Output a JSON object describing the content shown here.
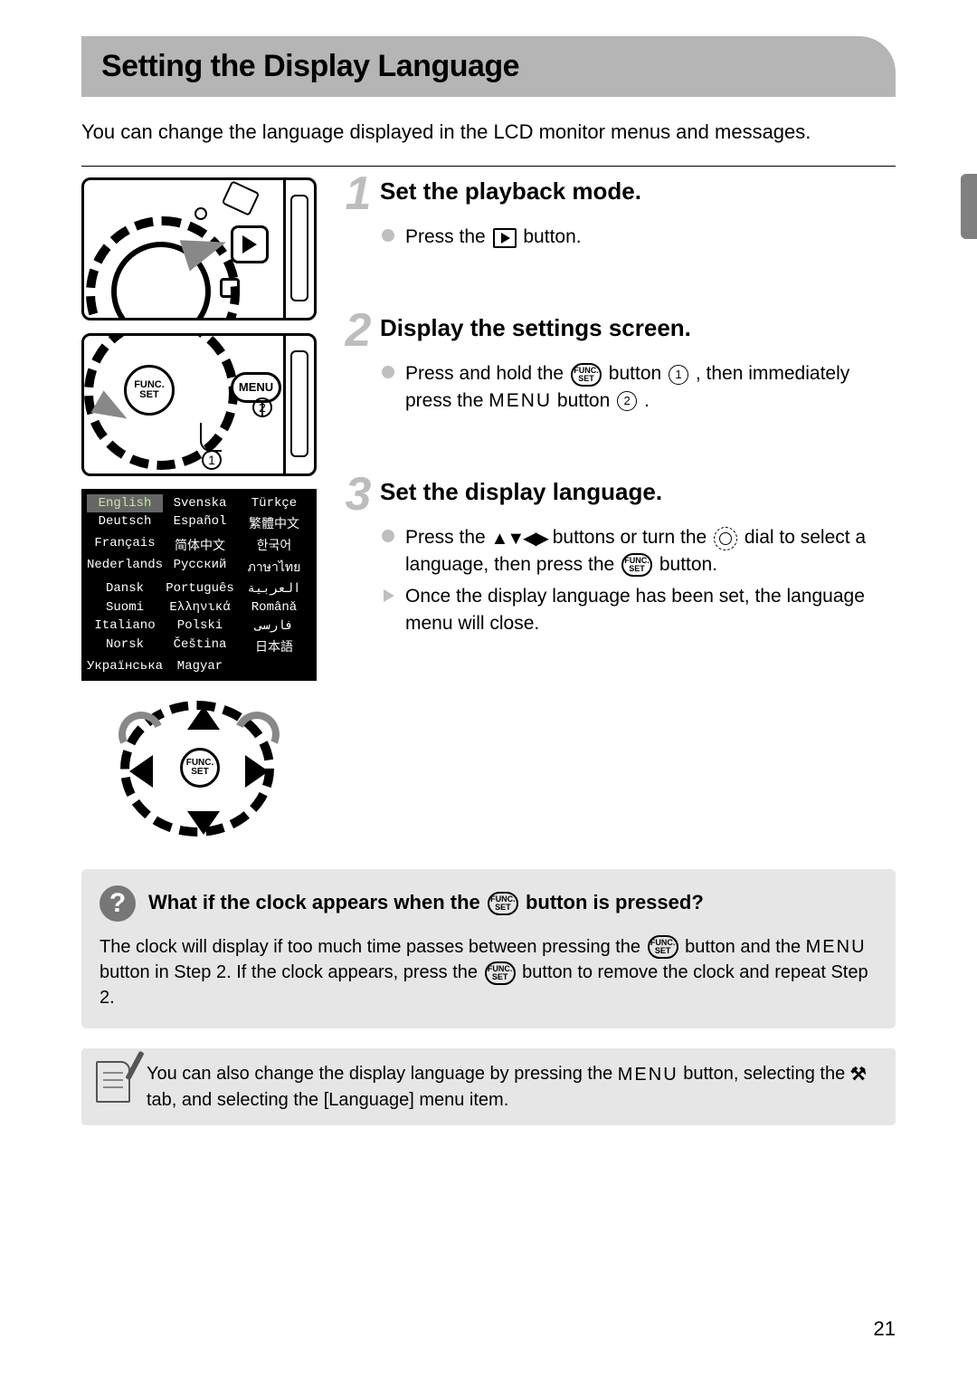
{
  "title": "Setting the Display Language",
  "intro": "You can change the language displayed in the LCD monitor menus and messages.",
  "steps": [
    {
      "num": "1",
      "title": "Set the playback mode.",
      "lines": [
        {
          "type": "circ",
          "pre": "Press the ",
          "icon": "play",
          "post": " button."
        }
      ]
    },
    {
      "num": "2",
      "title": "Display the settings screen.",
      "lines": [
        {
          "type": "circ",
          "segments": [
            "Press and hold the ",
            {
              "icon": "func"
            },
            " button ",
            {
              "icon": "cnum",
              "n": "1"
            },
            " , then immediately press the ",
            {
              "icon": "menu",
              "t": "MENU"
            },
            " button ",
            {
              "icon": "cnum",
              "n": "2"
            },
            " ."
          ]
        }
      ]
    },
    {
      "num": "3",
      "title": "Set the display language.",
      "lines": [
        {
          "type": "circ",
          "segments": [
            "Press the ",
            {
              "icon": "arrows",
              "t": "▲▼◀▶"
            },
            " buttons or turn the ",
            {
              "icon": "dial"
            },
            " dial to select a language, then press the ",
            {
              "icon": "func"
            },
            " button."
          ]
        },
        {
          "type": "tri",
          "segments": [
            "Once the display language has been set, the language menu will close."
          ]
        }
      ]
    }
  ],
  "languages": [
    "English",
    "Svenska",
    "Türkçe",
    "Deutsch",
    "Español",
    "繁體中文",
    "Français",
    "简体中文",
    "한국어",
    "Nederlands",
    "Русский",
    "ภาษาไทย",
    "Dansk",
    "Português",
    "العربية",
    "Suomi",
    "Ελληνικά",
    "Română",
    "Italiano",
    "Polski",
    "فارسی",
    "Norsk",
    "Čeština",
    "日本語",
    "Українська",
    "Magyar",
    ""
  ],
  "language_selected_index": 0,
  "dia2": {
    "func_top": "FUNC.",
    "func_bot": "SET",
    "menu": "MENU",
    "c1": "1",
    "c2": "2"
  },
  "dia4": {
    "func_top": "FUNC.",
    "func_bot": "SET"
  },
  "faq": {
    "icon": "?",
    "title_segments": [
      "What if the clock appears when the ",
      {
        "icon": "func"
      },
      " button is pressed?"
    ],
    "body_segments": [
      "The clock will display if too much time passes between pressing the ",
      {
        "icon": "func"
      },
      " button and the ",
      {
        "icon": "menu",
        "t": "MENU"
      },
      " button in Step 2. If the clock appears, press the ",
      {
        "icon": "func"
      },
      " button to remove the clock and repeat Step 2."
    ]
  },
  "note_segments": [
    "You can also change the display language by pressing the ",
    {
      "icon": "menu",
      "t": "MENU"
    },
    " button, selecting the ",
    {
      "icon": "tools",
      "t": "⚒"
    },
    " tab, and selecting the [Language] menu item."
  ],
  "page_number": "21"
}
